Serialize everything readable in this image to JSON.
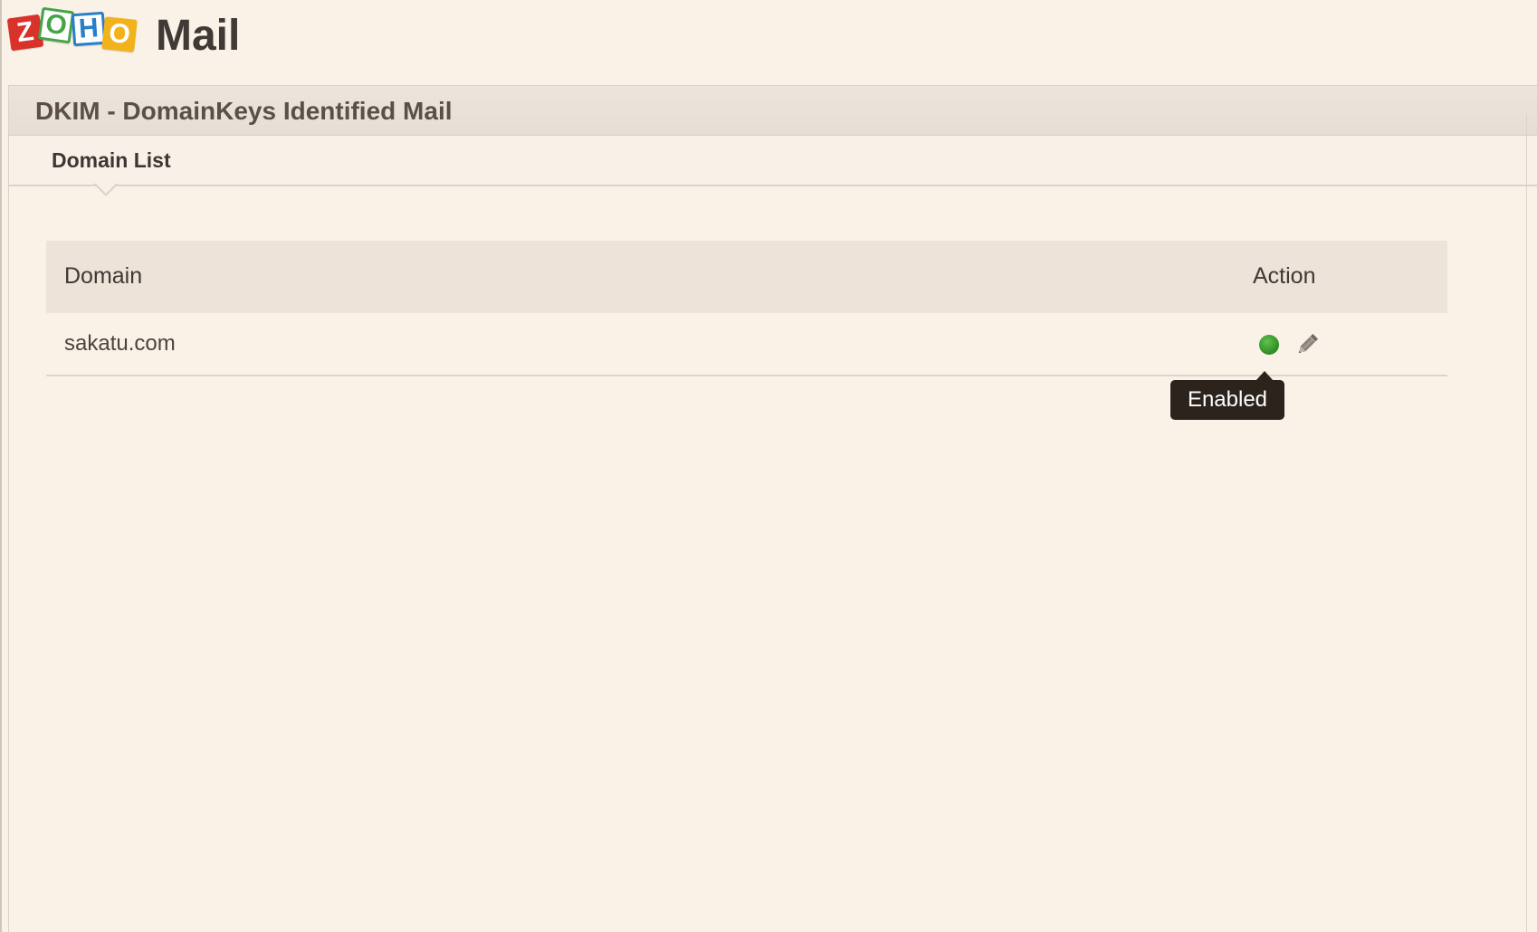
{
  "app": {
    "logo_letters": [
      "Z",
      "O",
      "H",
      "O"
    ],
    "logo_colors": [
      "#d9322b",
      "#43a548",
      "#2a7fc9",
      "#f2b21b"
    ],
    "logo_word": "Mail"
  },
  "panel": {
    "title": "DKIM - DomainKeys Identified Mail",
    "active_tab": "Domain List"
  },
  "table": {
    "columns": {
      "domain": "Domain",
      "action": "Action"
    },
    "rows": [
      {
        "domain": "sakatu.com",
        "status": "enabled",
        "status_color": "#3a9a2c",
        "edit_icon": "pencil-icon"
      }
    ]
  },
  "tooltip": {
    "text": "Enabled"
  }
}
